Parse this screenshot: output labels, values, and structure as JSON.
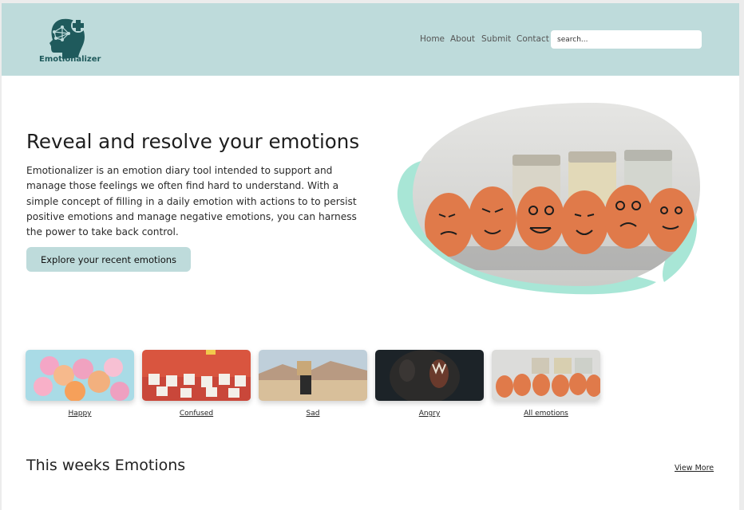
{
  "brand": {
    "name": "Emotionalizer"
  },
  "nav": {
    "items": [
      {
        "label": "Home"
      },
      {
        "label": "About"
      },
      {
        "label": "Submit"
      },
      {
        "label": "Contact"
      }
    ]
  },
  "search": {
    "placeholder": "search..."
  },
  "hero": {
    "title": "Reveal and resolve your emotions",
    "body": "Emotionalizer is an emotion diary tool intended to support and manage those feelings we often find hard to understand. With a simple concept of filling in a daily emotion with actions to to persist positive emotions and manage negative emotions, you can harness the power to take back control.",
    "cta_label": "Explore your recent emotions"
  },
  "emotions": [
    {
      "label": "Happy"
    },
    {
      "label": "Confused"
    },
    {
      "label": "Sad"
    },
    {
      "label": "Angry"
    },
    {
      "label": "All emotions"
    }
  ],
  "section": {
    "title": "This weeks Emotions",
    "view_more": "View More"
  },
  "colors": {
    "header_bg": "#bedbdb",
    "brand_dark": "#1f5a5c",
    "accent_mint": "#a8e6d6"
  }
}
